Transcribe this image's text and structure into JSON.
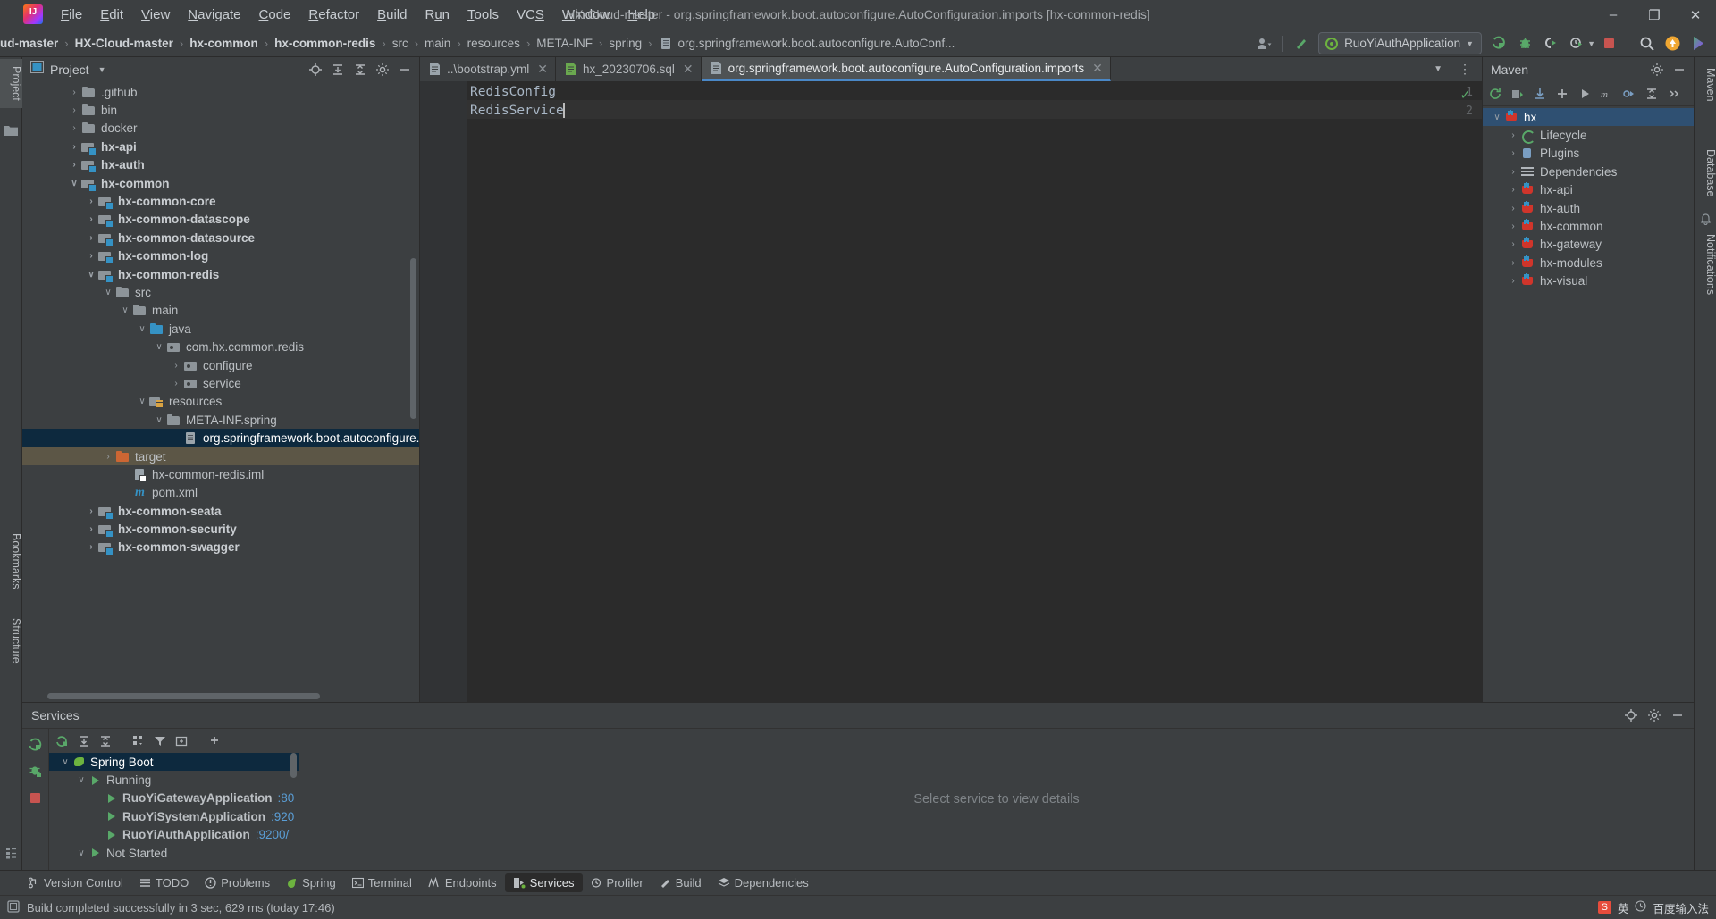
{
  "window": {
    "title": "HX-Cloud-master - org.springframework.boot.autoconfigure.AutoConfiguration.imports [hx-common-redis]",
    "minimize": "–",
    "maximize": "❐",
    "close": "✕"
  },
  "menu": {
    "items": [
      {
        "label": "File",
        "accel": "F"
      },
      {
        "label": "Edit",
        "accel": "E"
      },
      {
        "label": "View",
        "accel": "V"
      },
      {
        "label": "Navigate",
        "accel": "N"
      },
      {
        "label": "Code",
        "accel": "C"
      },
      {
        "label": "Refactor",
        "accel": "R"
      },
      {
        "label": "Build",
        "accel": "B"
      },
      {
        "label": "Run",
        "accel": "u"
      },
      {
        "label": "Tools",
        "accel": "T"
      },
      {
        "label": "VCS",
        "accel": "S"
      },
      {
        "label": "Window",
        "accel": "W"
      },
      {
        "label": "Help",
        "accel": "H"
      }
    ]
  },
  "breadcrumb": {
    "items": [
      {
        "label": "ud-master",
        "bold": true
      },
      {
        "label": "HX-Cloud-master",
        "bold": true
      },
      {
        "label": "hx-common",
        "bold": true
      },
      {
        "label": "hx-common-redis",
        "bold": true
      },
      {
        "label": "src",
        "bold": false
      },
      {
        "label": "main",
        "bold": false
      },
      {
        "label": "resources",
        "bold": false
      },
      {
        "label": "META-INF",
        "bold": false
      },
      {
        "label": "spring",
        "bold": false
      },
      {
        "label": "org.springframework.boot.autoconfigure.AutoConf...",
        "bold": false
      }
    ],
    "separator": "›"
  },
  "toolbar": {
    "run_config": "RuoYiAuthApplication",
    "icons": [
      "user-avatar-icon",
      "hammer-build-icon",
      "run-icon",
      "debug-icon",
      "run-with-coverage-icon",
      "profiler-icon",
      "stop-icon",
      "search-everywhere-icon",
      "updates-icon",
      "ide-features-icon"
    ]
  },
  "project_panel": {
    "title": "Project",
    "header_icons": [
      "locate-icon",
      "expand-all-icon",
      "collapse-all-icon",
      "settings-icon",
      "hide-icon"
    ],
    "tree": [
      {
        "label": ".github",
        "depth": 2,
        "arrow": "›",
        "icon": "folder",
        "bold": false,
        "state": ""
      },
      {
        "label": "bin",
        "depth": 2,
        "arrow": "›",
        "icon": "folder",
        "bold": false,
        "state": ""
      },
      {
        "label": "docker",
        "depth": 2,
        "arrow": "›",
        "icon": "folder",
        "bold": false,
        "state": ""
      },
      {
        "label": "hx-api",
        "depth": 2,
        "arrow": "›",
        "icon": "module",
        "bold": true,
        "state": ""
      },
      {
        "label": "hx-auth",
        "depth": 2,
        "arrow": "›",
        "icon": "module",
        "bold": true,
        "state": ""
      },
      {
        "label": "hx-common",
        "depth": 2,
        "arrow": "∨",
        "icon": "module",
        "bold": true,
        "state": ""
      },
      {
        "label": "hx-common-core",
        "depth": 3,
        "arrow": "›",
        "icon": "module",
        "bold": true,
        "state": ""
      },
      {
        "label": "hx-common-datascope",
        "depth": 3,
        "arrow": "›",
        "icon": "module",
        "bold": true,
        "state": ""
      },
      {
        "label": "hx-common-datasource",
        "depth": 3,
        "arrow": "›",
        "icon": "module",
        "bold": true,
        "state": ""
      },
      {
        "label": "hx-common-log",
        "depth": 3,
        "arrow": "›",
        "icon": "module",
        "bold": true,
        "state": ""
      },
      {
        "label": "hx-common-redis",
        "depth": 3,
        "arrow": "∨",
        "icon": "module",
        "bold": true,
        "state": ""
      },
      {
        "label": "src",
        "depth": 4,
        "arrow": "∨",
        "icon": "folder",
        "bold": false,
        "state": ""
      },
      {
        "label": "main",
        "depth": 5,
        "arrow": "∨",
        "icon": "folder",
        "bold": false,
        "state": ""
      },
      {
        "label": "java",
        "depth": 6,
        "arrow": "∨",
        "icon": "srcfolder",
        "bold": false,
        "state": ""
      },
      {
        "label": "com.hx.common.redis",
        "depth": 7,
        "arrow": "∨",
        "icon": "pkg",
        "bold": false,
        "state": ""
      },
      {
        "label": "configure",
        "depth": 8,
        "arrow": "›",
        "icon": "pkg",
        "bold": false,
        "state": ""
      },
      {
        "label": "service",
        "depth": 8,
        "arrow": "›",
        "icon": "pkg",
        "bold": false,
        "state": ""
      },
      {
        "label": "resources",
        "depth": 6,
        "arrow": "∨",
        "icon": "res",
        "bold": false,
        "state": ""
      },
      {
        "label": "META-INF.spring",
        "depth": 7,
        "arrow": "∨",
        "icon": "folder",
        "bold": false,
        "state": ""
      },
      {
        "label": "org.springframework.boot.autoconfigure.A",
        "depth": 8,
        "arrow": "",
        "icon": "file",
        "bold": false,
        "state": "sel"
      },
      {
        "label": "target",
        "depth": 4,
        "arrow": "›",
        "icon": "target",
        "bold": false,
        "state": "hl"
      },
      {
        "label": "hx-common-redis.iml",
        "depth": 5,
        "arrow": "",
        "icon": "iml",
        "bold": false,
        "state": ""
      },
      {
        "label": "pom.xml",
        "depth": 5,
        "arrow": "",
        "icon": "maven",
        "bold": false,
        "state": ""
      },
      {
        "label": "hx-common-seata",
        "depth": 3,
        "arrow": "›",
        "icon": "module",
        "bold": true,
        "state": ""
      },
      {
        "label": "hx-common-security",
        "depth": 3,
        "arrow": "›",
        "icon": "module",
        "bold": true,
        "state": ""
      },
      {
        "label": "hx-common-swagger",
        "depth": 3,
        "arrow": "›",
        "icon": "module",
        "bold": true,
        "state": ""
      }
    ]
  },
  "editor": {
    "tabs": [
      {
        "label": "..\\bootstrap.yml",
        "icon": "yaml-file-icon",
        "active": false
      },
      {
        "label": "hx_20230706.sql",
        "icon": "sql-file-icon",
        "active": false
      },
      {
        "label": "org.springframework.boot.autoconfigure.AutoConfiguration.imports",
        "icon": "text-file-icon",
        "active": true
      }
    ],
    "tab_right_icons": [
      "chevron-down-icon",
      "more-options-icon"
    ],
    "lines": [
      {
        "number": "1",
        "text": "RedisConfig"
      },
      {
        "number": "2",
        "text": "RedisService"
      }
    ],
    "inspection_status": "✓"
  },
  "maven_panel": {
    "title": "Maven",
    "header_icons": [
      "settings-icon",
      "hide-icon"
    ],
    "toolbar_icons": [
      "reload-icon",
      "generate-sources-icon",
      "download-sources-icon",
      "add-icon",
      "run-icon",
      "toggle-skip-tests-icon",
      "execute-goal-icon",
      "collapse-all-icon",
      "more-icon"
    ],
    "tree": [
      {
        "label": "hx",
        "depth": 0,
        "arrow": "∨",
        "icon": "mvn",
        "state": "sel"
      },
      {
        "label": "Lifecycle",
        "depth": 1,
        "arrow": "›",
        "icon": "lifecycle",
        "state": ""
      },
      {
        "label": "Plugins",
        "depth": 1,
        "arrow": "›",
        "icon": "plug",
        "state": ""
      },
      {
        "label": "Dependencies",
        "depth": 1,
        "arrow": "›",
        "icon": "deps",
        "state": ""
      },
      {
        "label": "hx-api",
        "depth": 1,
        "arrow": "›",
        "icon": "mvn",
        "state": ""
      },
      {
        "label": "hx-auth",
        "depth": 1,
        "arrow": "›",
        "icon": "mvn",
        "state": ""
      },
      {
        "label": "hx-common",
        "depth": 1,
        "arrow": "›",
        "icon": "mvn",
        "state": ""
      },
      {
        "label": "hx-gateway",
        "depth": 1,
        "arrow": "›",
        "icon": "mvn",
        "state": ""
      },
      {
        "label": "hx-modules",
        "depth": 1,
        "arrow": "›",
        "icon": "mvn",
        "state": ""
      },
      {
        "label": "hx-visual",
        "depth": 1,
        "arrow": "›",
        "icon": "mvn",
        "state": ""
      }
    ]
  },
  "services_panel": {
    "title": "Services",
    "header_icons": [
      "locate-icon",
      "settings-icon",
      "hide-icon"
    ],
    "rail_icons": [
      "rerun-icon",
      "debug-icon",
      "stop-icon"
    ],
    "toolbar_icons": [
      "rerun-icon",
      "expand-all-icon",
      "collapse-all-icon",
      "group-by-icon",
      "filter-icon",
      "add-tab-icon",
      "add-service-icon"
    ],
    "tree": [
      {
        "label": "Spring Boot",
        "depth": 0,
        "arrow": "∨",
        "icon": "spring",
        "port": "",
        "bold": false,
        "state": "sel"
      },
      {
        "label": "Running",
        "depth": 1,
        "arrow": "∨",
        "icon": "play",
        "port": "",
        "bold": false,
        "state": ""
      },
      {
        "label": "RuoYiGatewayApplication",
        "depth": 2,
        "arrow": "",
        "icon": "play",
        "port": ":80",
        "bold": true,
        "state": ""
      },
      {
        "label": "RuoYiSystemApplication",
        "depth": 2,
        "arrow": "",
        "icon": "play",
        "port": ":920",
        "bold": true,
        "state": ""
      },
      {
        "label": "RuoYiAuthApplication",
        "depth": 2,
        "arrow": "",
        "icon": "play",
        "port": ":9200/",
        "bold": true,
        "state": ""
      },
      {
        "label": "Not Started",
        "depth": 1,
        "arrow": "∨",
        "icon": "play",
        "port": "",
        "bold": false,
        "state": ""
      }
    ],
    "detail_placeholder": "Select service to view details"
  },
  "toolwindow_bar": {
    "items": [
      {
        "label": "Version Control",
        "icon": "branch-icon",
        "active": false
      },
      {
        "label": "TODO",
        "icon": "list-icon",
        "active": false
      },
      {
        "label": "Problems",
        "icon": "warning-icon",
        "active": false
      },
      {
        "label": "Spring",
        "icon": "spring-leaf-icon",
        "active": false
      },
      {
        "label": "Terminal",
        "icon": "terminal-icon",
        "active": false
      },
      {
        "label": "Endpoints",
        "icon": "endpoints-icon",
        "active": false
      },
      {
        "label": "Services",
        "icon": "services-icon",
        "active": true
      },
      {
        "label": "Profiler",
        "icon": "profiler-icon",
        "active": false
      },
      {
        "label": "Build",
        "icon": "hammer-icon",
        "active": false
      },
      {
        "label": "Dependencies",
        "icon": "layers-icon",
        "active": false
      }
    ]
  },
  "statusbar": {
    "icon": "build-status-icon",
    "message": "Build completed successfully in 3 sec, 629 ms (today 17:46)",
    "ime": {
      "logo": "S",
      "lang": "英",
      "extra": "百度输入法"
    }
  },
  "left_strip": {
    "items": [
      {
        "label": "Project",
        "selected": true
      },
      {
        "label": "Bookmarks",
        "selected": false
      },
      {
        "label": "Structure",
        "selected": false
      }
    ]
  },
  "right_strip": {
    "items": [
      {
        "label": "Maven",
        "selected": false
      },
      {
        "label": "Database",
        "selected": false
      },
      {
        "label": "Notifications",
        "selected": false
      }
    ]
  },
  "colors": {
    "accent": "#3592c4",
    "selection": "#0d293e",
    "green": "#59a869",
    "panel_bg": "#3c3f41",
    "editor_bg": "#2b2b2b"
  }
}
